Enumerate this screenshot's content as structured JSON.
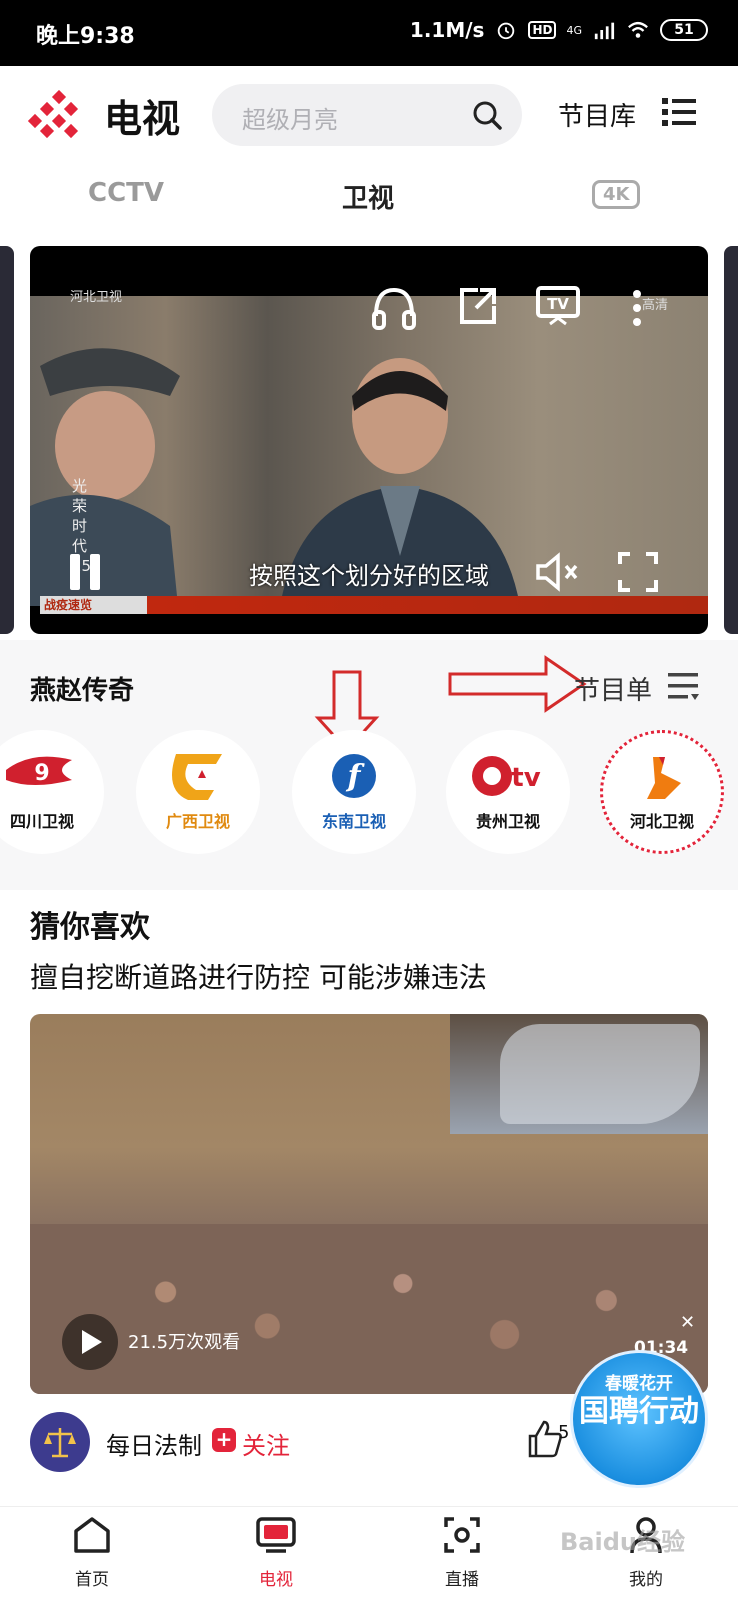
{
  "status_bar": {
    "time": "晚上9:38",
    "net_speed": "1.1M/s",
    "hd": "HD",
    "signal": "4G",
    "battery": "51"
  },
  "header": {
    "title": "电视",
    "search_placeholder": "超级月亮",
    "library_label": "节目库"
  },
  "tabs": [
    {
      "label": "CCTV"
    },
    {
      "label": "卫视",
      "active": true
    },
    {
      "label": "4K"
    }
  ],
  "player": {
    "channel_logo": "河北卫视",
    "hq": "高清",
    "vertical_title": "光荣时代25",
    "subtitle": "按照这个划分好的区域",
    "ticker": "战疫速览"
  },
  "channels_section": {
    "program_name": "燕赵传奇",
    "schedule_label": "节目单",
    "channels": [
      {
        "name": "四川卫视"
      },
      {
        "name": "广西卫视"
      },
      {
        "name": "东南卫视"
      },
      {
        "name": "贵州卫视"
      },
      {
        "name": "河北卫视",
        "active": true
      }
    ]
  },
  "recommend": {
    "title": "猜你喜欢",
    "headline": "擅自挖断道路进行防控 可能涉嫌违法",
    "views": "21.5万次观看",
    "duration": "01:34",
    "author": "每日法制",
    "follow_label": "关注",
    "likes": "57",
    "badge_top": "春暖花开",
    "badge_main": "国聘行动"
  },
  "bottom_nav": [
    {
      "label": "首页",
      "icon": "home-icon"
    },
    {
      "label": "电视",
      "icon": "tv-icon",
      "active": true
    },
    {
      "label": "直播",
      "icon": "live-icon"
    },
    {
      "label": "我的",
      "icon": "profile-icon"
    }
  ],
  "watermark": "Baidu经验",
  "colors": {
    "accent": "#e3243a",
    "dark": "#111111",
    "muted": "#9a9a9a"
  }
}
